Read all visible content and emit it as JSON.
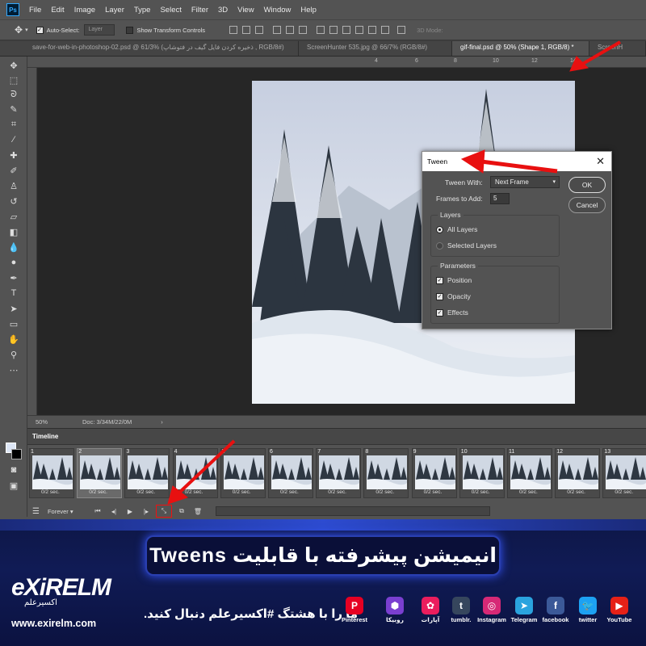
{
  "app": {
    "logo": "Ps"
  },
  "menu": [
    "File",
    "Edit",
    "Image",
    "Layer",
    "Type",
    "Select",
    "Filter",
    "3D",
    "View",
    "Window",
    "Help"
  ],
  "options_bar": {
    "auto_select_label": "Auto-Select:",
    "auto_select_value": "Layer",
    "transform_label": "Show Transform Controls",
    "mode_label": "3D Mode:"
  },
  "tabs": [
    {
      "label": "save-for-web-in-photoshop-02.psd @ 61/3% (ذخیره کردن فایل گیف در فتوشاپ , RGB/8#)"
    },
    {
      "label": "ScreenHunter 535.jpg @ 66/7% (RGB/8#)"
    },
    {
      "label": "gif-final.psd @ 50% (Shape 1, RGB/8) *"
    },
    {
      "label": "ScreenH"
    }
  ],
  "ruler_labels": [
    "4",
    "6",
    "8",
    "10",
    "12",
    "14"
  ],
  "status": {
    "zoom": "50%",
    "doc": "Doc: 3/34M/22/0M"
  },
  "timeline": {
    "title": "Timeline",
    "frames": [
      {
        "num": "1",
        "delay": "0/2 sec."
      },
      {
        "num": "2",
        "delay": "0/2 sec."
      },
      {
        "num": "3",
        "delay": "0/2 sec."
      },
      {
        "num": "4",
        "delay": "0/2 sec."
      },
      {
        "num": "5",
        "delay": "0/2 sec."
      },
      {
        "num": "6",
        "delay": "0/2 sec."
      },
      {
        "num": "7",
        "delay": "0/2 sec."
      },
      {
        "num": "8",
        "delay": "0/2 sec."
      },
      {
        "num": "9",
        "delay": "0/2 sec."
      },
      {
        "num": "10",
        "delay": "0/2 sec."
      },
      {
        "num": "11",
        "delay": "0/2 sec."
      },
      {
        "num": "12",
        "delay": "0/2 sec."
      },
      {
        "num": "13",
        "delay": "0/2 sec."
      }
    ],
    "loop": "Forever"
  },
  "dialog": {
    "title": "Tween",
    "tween_with_label": "Tween With:",
    "tween_with_value": "Next Frame",
    "frames_to_add_label": "Frames to Add:",
    "frames_to_add_value": "5",
    "layers_group": "Layers",
    "all_layers": "All Layers",
    "selected_layers": "Selected Layers",
    "params_group": "Parameters",
    "position": "Position",
    "opacity": "Opacity",
    "effects": "Effects",
    "ok": "OK",
    "cancel": "Cancel"
  },
  "banner": {
    "headline": "انیمیشن پیشرفته با قابلیت Tweens",
    "tagline": "ما را با هشتگ #اکسیرعلم دنبال کنید.",
    "logo": "eXiRELM",
    "logo_sub": "اکسیرعلم",
    "url": "www.exirelm.com",
    "social": [
      {
        "label": "Pinterest",
        "color": "#e60023",
        "glyph": "P"
      },
      {
        "label": "روبیکا",
        "color": "#7a3fd0",
        "glyph": "⬢"
      },
      {
        "label": "آپارات",
        "color": "#ea1d5d",
        "glyph": "✿"
      },
      {
        "label": "tumblr.",
        "color": "#36465d",
        "glyph": "t"
      },
      {
        "label": "Instagram",
        "color": "#d62976",
        "glyph": "◎"
      },
      {
        "label": "Telegram",
        "color": "#2aa3de",
        "glyph": "➤"
      },
      {
        "label": "facebook",
        "color": "#3b5998",
        "glyph": "f"
      },
      {
        "label": "twitter",
        "color": "#1da1f2",
        "glyph": "🐦"
      },
      {
        "label": "YouTube",
        "color": "#e62117",
        "glyph": "▶"
      }
    ]
  },
  "colors": {
    "annotation_arrow": "#e81010",
    "ps_bg": "#535353",
    "banner_bg": "#101b55"
  }
}
